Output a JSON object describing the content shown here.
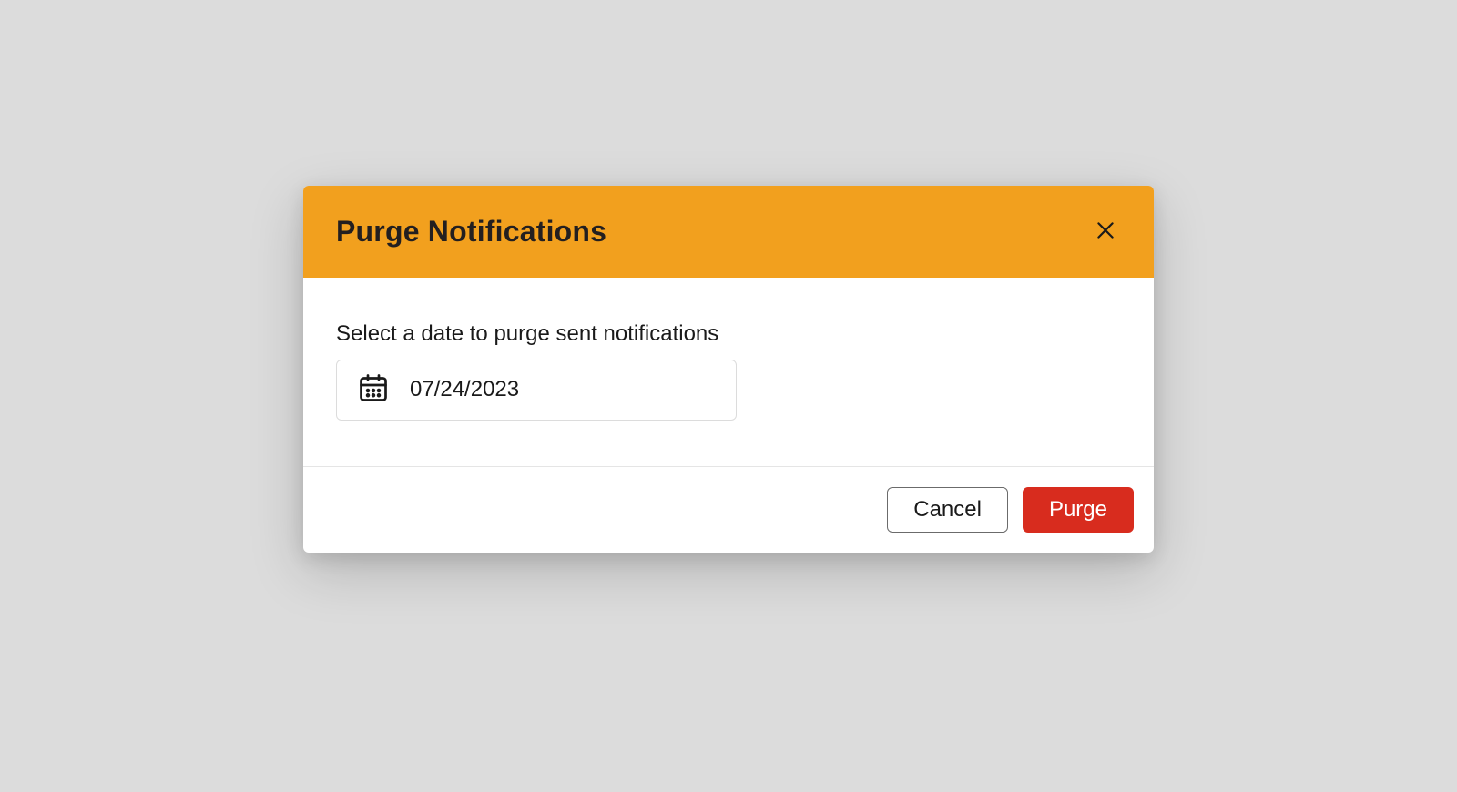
{
  "modal": {
    "title": "Purge Notifications",
    "prompt": "Select a date to purge sent notifications",
    "date_value": "07/24/2023",
    "cancel_label": "Cancel",
    "purge_label": "Purge"
  }
}
